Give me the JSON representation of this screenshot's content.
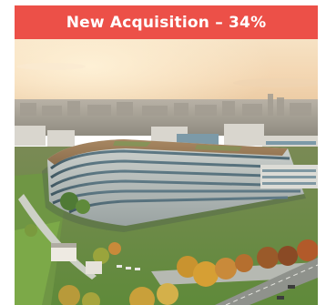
{
  "banner": {
    "title": "New Acquisition – 34%",
    "background_color": "#ec5048",
    "text_color": "#ffffff"
  },
  "photo": {
    "subject": "aerial-view-curved-office-building"
  }
}
